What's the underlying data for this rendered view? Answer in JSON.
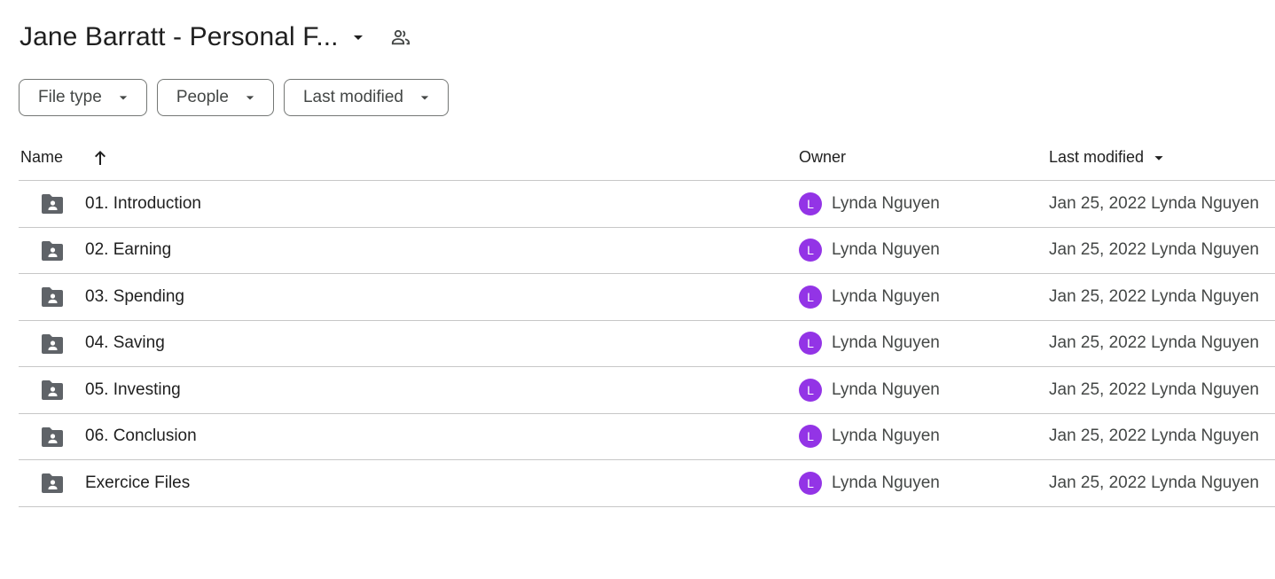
{
  "header": {
    "title": "Jane Barratt - Personal F...",
    "title_caret_icon": "arrow-drop-down-icon",
    "share_icon": "people-icon"
  },
  "filters": [
    {
      "label": "File type"
    },
    {
      "label": "People"
    },
    {
      "label": "Last modified"
    }
  ],
  "columns": {
    "name": "Name",
    "owner": "Owner",
    "last_modified": "Last modified",
    "sort_icon": "arrow-upward-icon"
  },
  "colors": {
    "avatar": "#9334e6",
    "icon": "#5f6368"
  },
  "rows": [
    {
      "name": "01. Introduction",
      "owner_initial": "L",
      "owner": "Lynda Nguyen",
      "modified": "Jan 25, 2022 Lynda Nguyen"
    },
    {
      "name": "02. Earning",
      "owner_initial": "L",
      "owner": "Lynda Nguyen",
      "modified": "Jan 25, 2022 Lynda Nguyen"
    },
    {
      "name": "03. Spending",
      "owner_initial": "L",
      "owner": "Lynda Nguyen",
      "modified": "Jan 25, 2022 Lynda Nguyen"
    },
    {
      "name": "04. Saving",
      "owner_initial": "L",
      "owner": "Lynda Nguyen",
      "modified": "Jan 25, 2022 Lynda Nguyen"
    },
    {
      "name": "05. Investing",
      "owner_initial": "L",
      "owner": "Lynda Nguyen",
      "modified": "Jan 25, 2022 Lynda Nguyen"
    },
    {
      "name": "06. Conclusion",
      "owner_initial": "L",
      "owner": "Lynda Nguyen",
      "modified": "Jan 25, 2022 Lynda Nguyen"
    },
    {
      "name": "Exercice Files",
      "owner_initial": "L",
      "owner": "Lynda Nguyen",
      "modified": "Jan 25, 2022 Lynda Nguyen"
    }
  ]
}
